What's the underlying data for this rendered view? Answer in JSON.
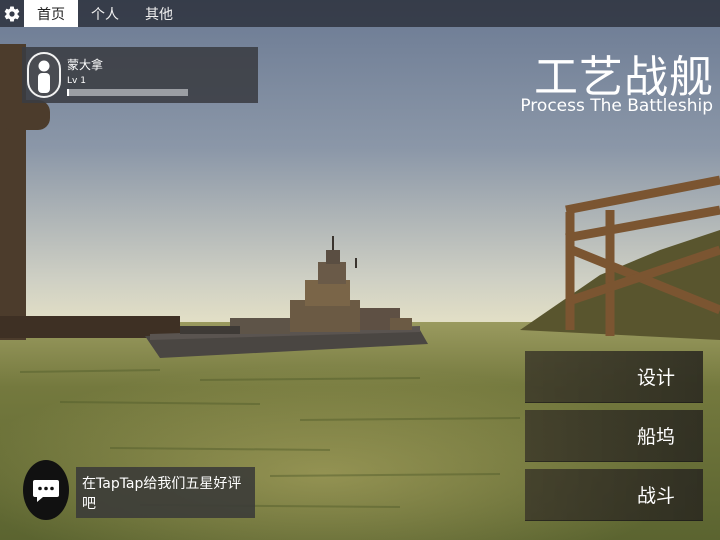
{
  "tabs": [
    {
      "label": "首页",
      "active": true
    },
    {
      "label": "个人",
      "active": false
    },
    {
      "label": "其他",
      "active": false
    }
  ],
  "profile": {
    "name": "蒙大拿",
    "level": "Lv 1",
    "xp_fraction": 0.02
  },
  "title": {
    "cn": "工艺战舰",
    "en": "Process The Battleship"
  },
  "menu": {
    "design": "设计",
    "dock": "船坞",
    "battle": "战斗"
  },
  "review": {
    "text": "在TapTap给我们五星好评吧"
  },
  "icons": {
    "settings": "gear-icon",
    "avatar": "person-silhouette-icon",
    "chat": "chat-bubble-icon"
  },
  "colors": {
    "sky_top": "#6e7e97",
    "sky_horizon": "#dbd9c2",
    "water": "#6a7238",
    "ship": "#4a4642",
    "structure": "#7b5531"
  }
}
